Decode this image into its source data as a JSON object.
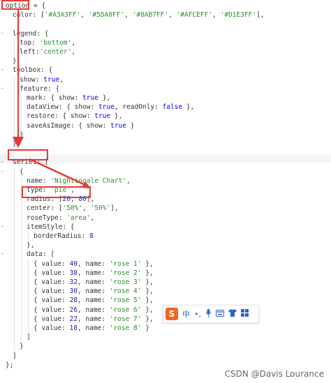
{
  "code": {
    "lines": [
      {
        "indent": 0,
        "text": "option = {"
      },
      {
        "indent": 1,
        "text": "color: ['#A3A3FF', '#5DA0FF', '#8AB7FF', '#AFCEFF', '#D1E3FF'],"
      },
      {
        "indent": 0,
        "text": ""
      },
      {
        "indent": 1,
        "text": "legend: {"
      },
      {
        "indent": 2,
        "text": "top: 'bottom',"
      },
      {
        "indent": 2,
        "text": "left:'center',"
      },
      {
        "indent": 1,
        "text": "},"
      },
      {
        "indent": 1,
        "text": "toolbox: {"
      },
      {
        "indent": 2,
        "text": "show: true,"
      },
      {
        "indent": 2,
        "text": "feature: {"
      },
      {
        "indent": 3,
        "text": "mark: { show: true },"
      },
      {
        "indent": 3,
        "text": "dataView: { show: true, readOnly: false },"
      },
      {
        "indent": 3,
        "text": "restore: { show: true },"
      },
      {
        "indent": 3,
        "text": "saveAsImage: { show: true }"
      },
      {
        "indent": 2,
        "text": "}"
      },
      {
        "indent": 1,
        "text": "},"
      },
      {
        "indent": 0,
        "text": ""
      },
      {
        "indent": 1,
        "text": "series: ["
      },
      {
        "indent": 2,
        "text": "{"
      },
      {
        "indent": 3,
        "text": "name: 'Nightingale Chart',"
      },
      {
        "indent": 3,
        "text": "type: 'pie',"
      },
      {
        "indent": 3,
        "text": "radius: [20, 80],"
      },
      {
        "indent": 3,
        "text": "center: ['50%', '50%'],"
      },
      {
        "indent": 3,
        "text": "roseType: 'area',"
      },
      {
        "indent": 3,
        "text": "itemStyle: {"
      },
      {
        "indent": 4,
        "text": "borderRadius: 8"
      },
      {
        "indent": 3,
        "text": "},"
      },
      {
        "indent": 3,
        "text": "data: ["
      },
      {
        "indent": 4,
        "text": "{ value: 40, name: 'rose 1' },"
      },
      {
        "indent": 4,
        "text": "{ value: 38, name: 'rose 2' },"
      },
      {
        "indent": 4,
        "text": "{ value: 32, name: 'rose 3' },"
      },
      {
        "indent": 4,
        "text": "{ value: 30, name: 'rose 4' },"
      },
      {
        "indent": 4,
        "text": "{ value: 28, name: 'rose 5' },"
      },
      {
        "indent": 4,
        "text": "{ value: 26, name: 'rose 6' },"
      },
      {
        "indent": 4,
        "text": "{ value: 22, name: 'rose 7' },"
      },
      {
        "indent": 4,
        "text": "{ value: 18, name: 'rose 8' }"
      },
      {
        "indent": 3,
        "text": "]"
      },
      {
        "indent": 2,
        "text": "}"
      },
      {
        "indent": 1,
        "text": "]"
      },
      {
        "indent": 0,
        "text": "};"
      }
    ]
  },
  "ime_toolbar": {
    "logo": "S",
    "lang": "中",
    "items": [
      "•,",
      "mic-icon",
      "keyboard-icon",
      "shirt-icon",
      "grid-icon"
    ]
  },
  "watermark": "CSDN @Davis Lourance",
  "highlight_color": "#e53935"
}
